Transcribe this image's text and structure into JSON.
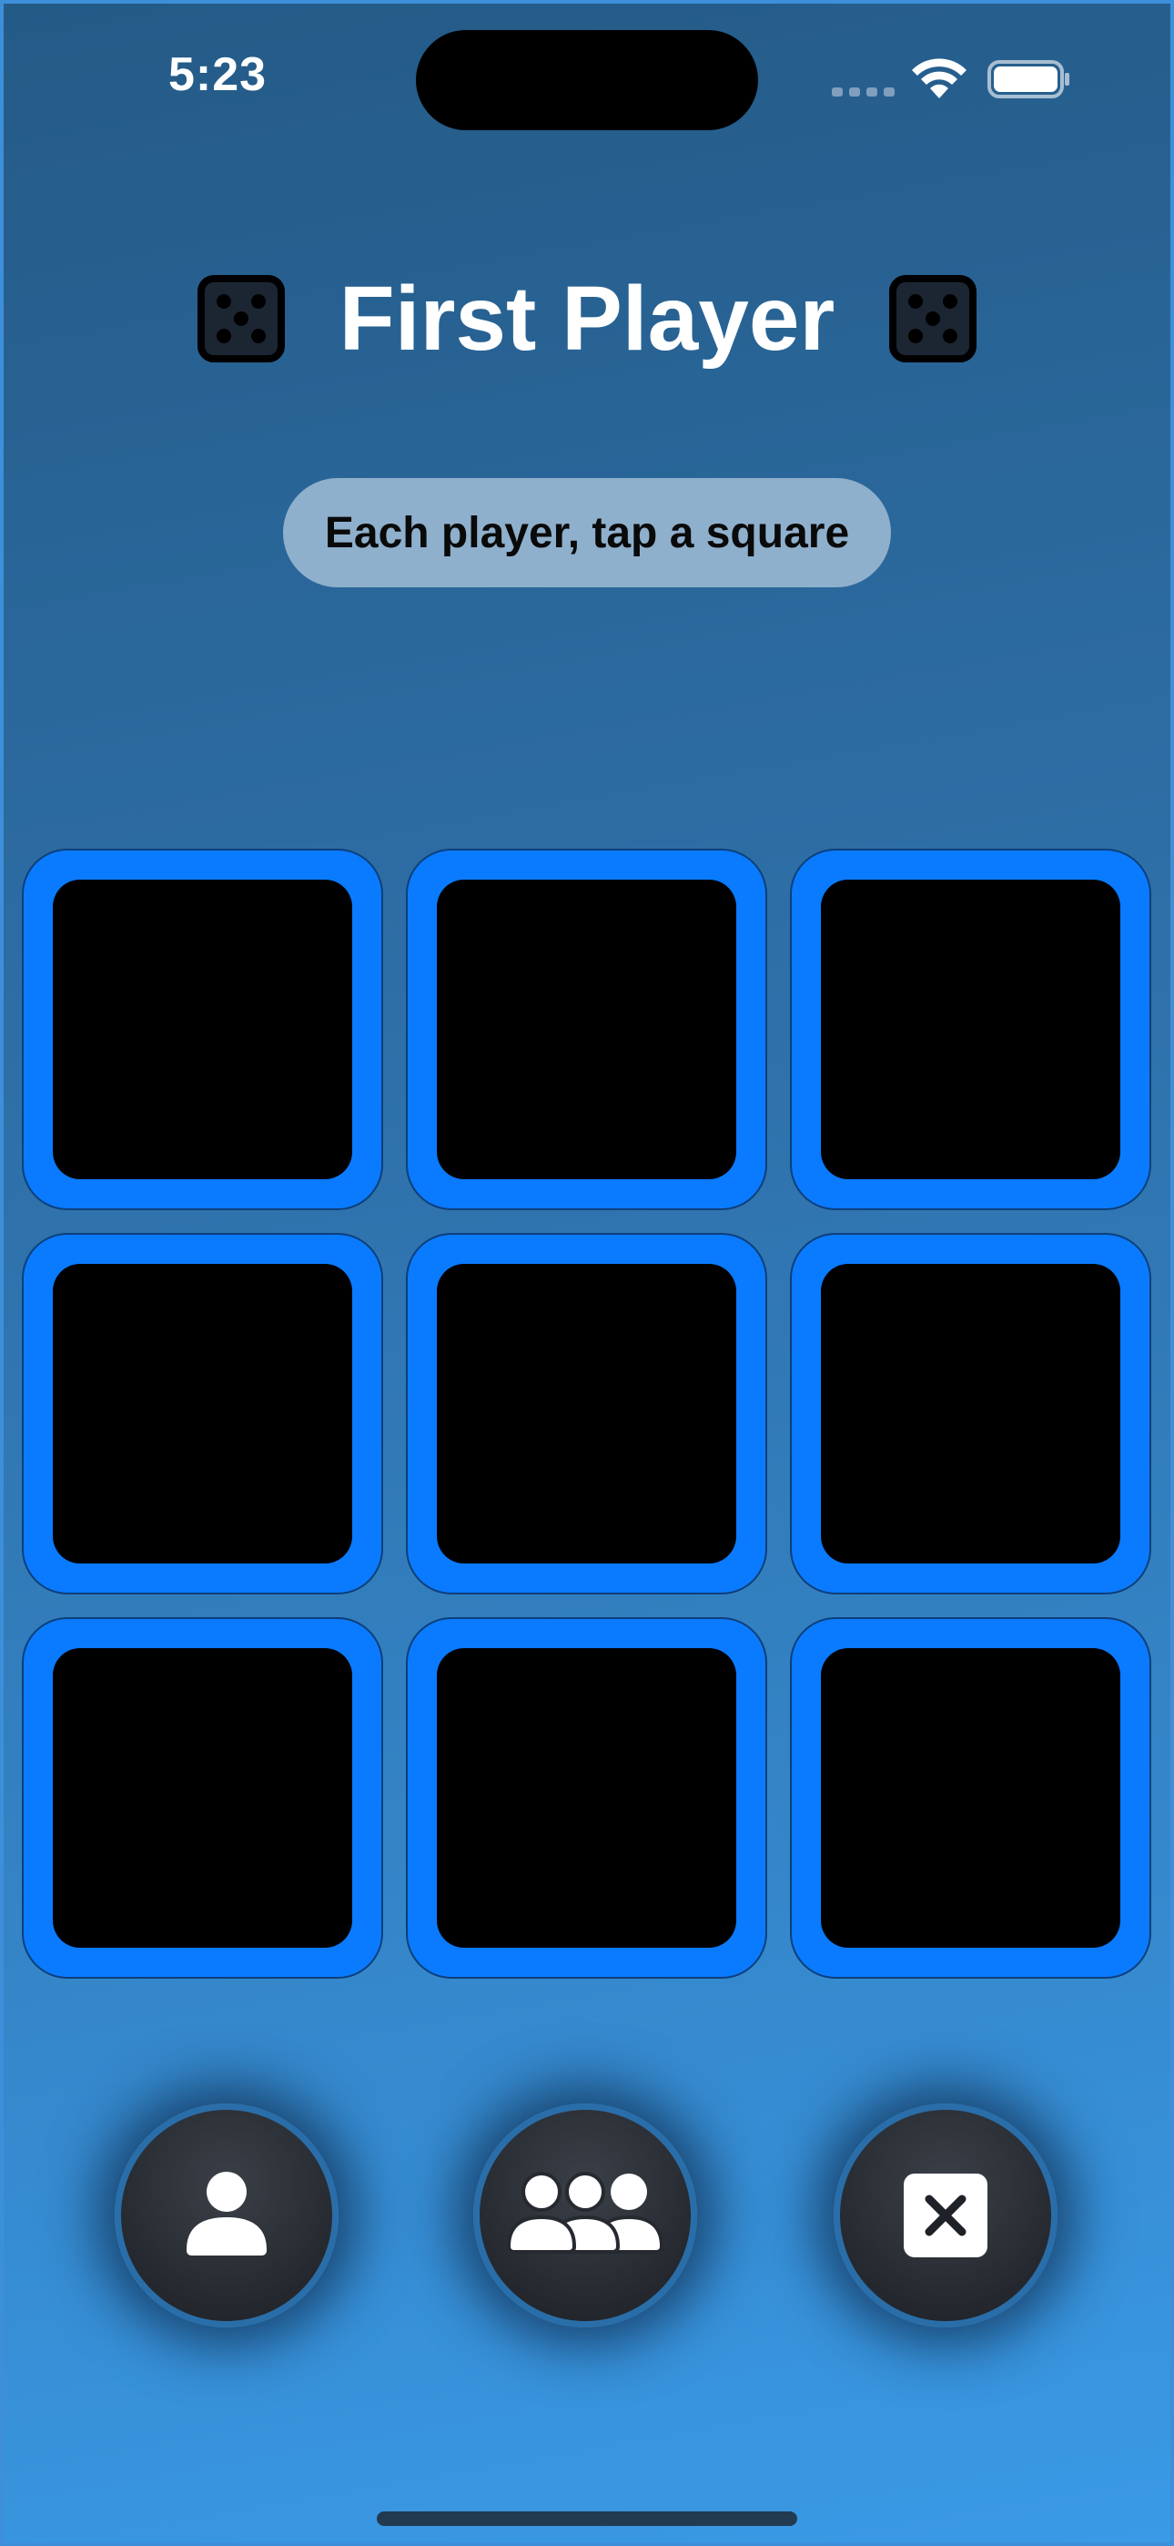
{
  "status_bar": {
    "time": "5:23"
  },
  "header": {
    "title": "First Player",
    "left_icon": "die-five-icon",
    "right_icon": "die-five-icon"
  },
  "instruction": {
    "text": "Each player, tap a square"
  },
  "board": {
    "rows": 3,
    "columns": 3,
    "square_color": "#0a7bff",
    "square_fill": "#000000"
  },
  "controls": {
    "buttons": [
      {
        "icon": "single-person-icon"
      },
      {
        "icon": "group-people-icon"
      },
      {
        "icon": "close-x-icon"
      }
    ]
  },
  "colors": {
    "accent": "#0a7bff",
    "background_top": "#245a86",
    "background_bottom": "#3a9ae6",
    "pill": "#8fb0cc"
  }
}
